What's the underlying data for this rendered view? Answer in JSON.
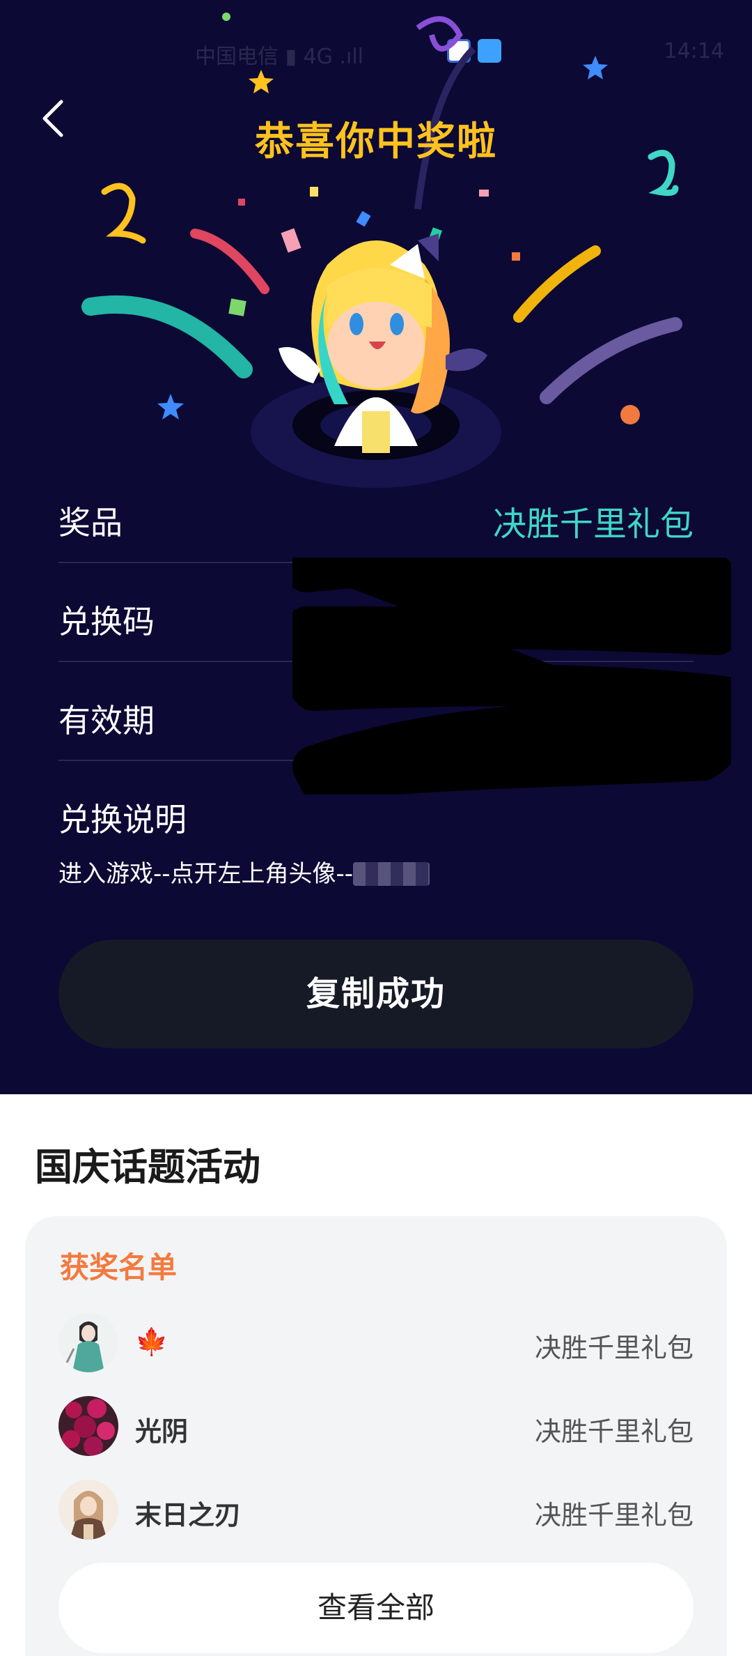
{
  "status_bar": {
    "carrier": "中国电信 ▮ 4G .ıll",
    "time": "14:14"
  },
  "header": {
    "back_icon": "chevron-left-icon",
    "title": "恭喜你中奖啦"
  },
  "prize_info": {
    "prize_label": "奖品",
    "prize_value": "决胜千里礼包",
    "code_label": "兑换码",
    "validity_label": "有效期",
    "instructions_label": "兑换说明",
    "instructions_text": "进入游戏--点开左上角头像--"
  },
  "copy_button": {
    "label": "复制成功"
  },
  "activity": {
    "title": "国庆话题活动",
    "winners_title": "获奖名单",
    "winners": [
      {
        "name": "🍁",
        "prize": "决胜千里礼包",
        "avatar": "anime-girl-avatar"
      },
      {
        "name": "光阴",
        "prize": "决胜千里礼包",
        "avatar": "flower-avatar"
      },
      {
        "name": "末日之刃",
        "prize": "决胜千里礼包",
        "avatar": "anime-character-avatar"
      }
    ],
    "view_all_label": "查看全部"
  },
  "colors": {
    "background_dark": "#0c0935",
    "title_gold": "#ffc21e",
    "prize_teal": "#3fd7c7",
    "winners_orange": "#f37a3e",
    "button_dark": "#161a27"
  }
}
